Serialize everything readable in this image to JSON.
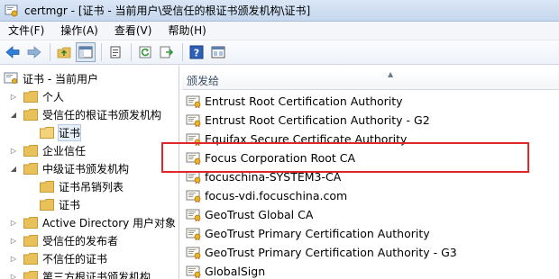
{
  "window": {
    "title": "certmgr - [证书 - 当前用户\\受信任的根证书颁发机构\\证书]",
    "app_icon": "certificate-manager-icon"
  },
  "menu": [
    {
      "label": "文件(F)"
    },
    {
      "label": "操作(A)"
    },
    {
      "label": "查看(V)"
    },
    {
      "label": "帮助(H)"
    }
  ],
  "toolbar": {
    "buttons": [
      "back-arrow-icon",
      "forward-arrow-icon",
      "up-folder-icon",
      "show-hide-tree-icon",
      "properties-icon",
      "refresh-icon",
      "export-list-icon",
      "help-icon",
      "mmc-icon"
    ]
  },
  "tree": [
    {
      "label": "证书 - 当前用户",
      "expander": "",
      "icon": "certificates-root-icon",
      "level": 0
    },
    {
      "label": "个人",
      "expander": "▷",
      "icon": "folder-icon",
      "level": 1
    },
    {
      "label": "受信任的根证书颁发机构",
      "expander": "◢",
      "icon": "folder-icon",
      "level": 1
    },
    {
      "label": "证书",
      "expander": "",
      "icon": "folder-open-icon",
      "level": 2,
      "selected": true
    },
    {
      "label": "企业信任",
      "expander": "▷",
      "icon": "folder-icon",
      "level": 1
    },
    {
      "label": "中级证书颁发机构",
      "expander": "◢",
      "icon": "folder-icon",
      "level": 1
    },
    {
      "label": "证书吊销列表",
      "expander": "",
      "icon": "folder-icon",
      "level": 2
    },
    {
      "label": "证书",
      "expander": "",
      "icon": "folder-icon",
      "level": 2
    },
    {
      "label": "Active Directory 用户对象",
      "expander": "▷",
      "icon": "folder-icon",
      "level": 1
    },
    {
      "label": "受信任的发布者",
      "expander": "▷",
      "icon": "folder-icon",
      "level": 1
    },
    {
      "label": "不信任的证书",
      "expander": "▷",
      "icon": "folder-icon",
      "level": 1
    },
    {
      "label": "第三方根证书颁发机构",
      "expander": "▷",
      "icon": "folder-icon",
      "level": 1
    }
  ],
  "list": {
    "column_header": "颁发给",
    "rows": [
      "Entrust Root Certification Authority",
      "Entrust Root Certification Authority - G2",
      "Equifax Secure Certificate Authority",
      "Focus Corporation Root CA",
      "focuschina-SYSTEM3-CA",
      "focus-vdi.focuschina.com",
      "GeoTrust Global CA",
      "GeoTrust Primary Certification Authority",
      "GeoTrust Primary Certification Authority - G3",
      "GlobalSign"
    ]
  },
  "colors": {
    "highlight": "#e02828",
    "folder": "#e8c15a",
    "titlebar": "#c5d7ee"
  }
}
